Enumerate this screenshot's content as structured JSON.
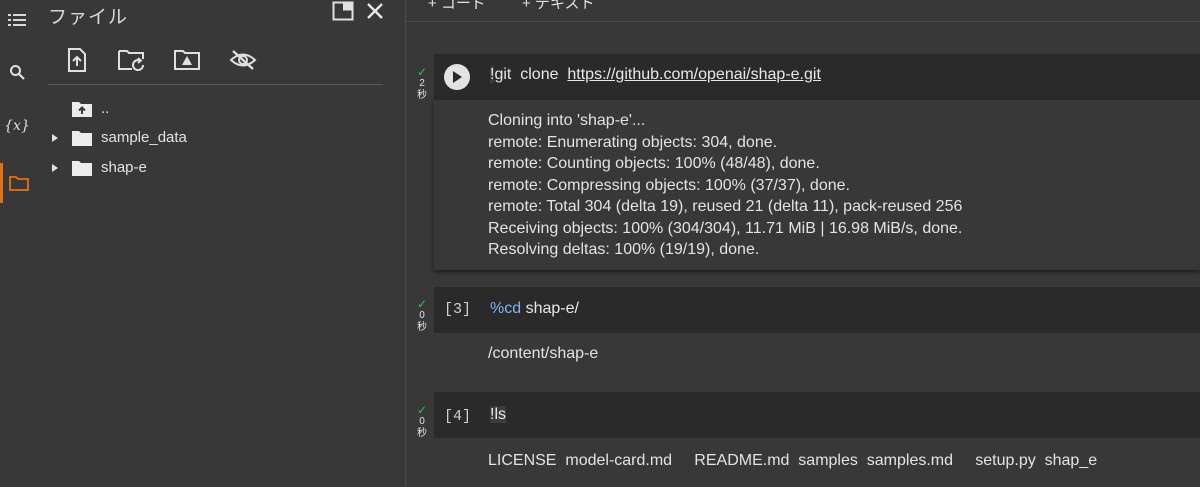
{
  "sidebar": {
    "title": "ファイル",
    "rail": [
      "menu-icon",
      "search-icon",
      "variables-icon",
      "folder-icon"
    ],
    "variables_label": "{x}",
    "tree": [
      {
        "label": "..",
        "type": "parent"
      },
      {
        "label": "sample_data",
        "type": "folder"
      },
      {
        "label": "shap-e",
        "type": "folder"
      }
    ]
  },
  "toolbar": {
    "add_code": "+ コード",
    "add_text": "+ テキスト"
  },
  "cells": [
    {
      "status_check": "✓",
      "status_time_num": "2",
      "status_time_unit": "秒",
      "prompt": "",
      "code_bang": "!",
      "code_cmd": "git  clone  ",
      "code_url": "https://github.com/openai/shap-e.git",
      "output": [
        "Cloning into 'shap-e'...",
        "remote: Enumerating objects: 304, done.",
        "remote: Counting objects: 100% (48/48), done.",
        "remote: Compressing objects: 100% (37/37), done.",
        "remote: Total 304 (delta 19), reused 21 (delta 11), pack-reused 256",
        "Receiving objects: 100% (304/304), 11.71 MiB | 16.98 MiB/s, done.",
        "Resolving deltas: 100% (19/19), done."
      ]
    },
    {
      "status_check": "✓",
      "status_time_num": "0",
      "status_time_unit": "秒",
      "prompt": "[3]",
      "code_magic": "%cd",
      "code_arg": " shap-e/",
      "output": [
        "/content/shap-e"
      ]
    },
    {
      "status_check": "✓",
      "status_time_num": "0",
      "status_time_unit": "秒",
      "prompt": "[4]",
      "code_bang": "!",
      "code_cmd": "ls",
      "output": [
        "LICENSE  model-card.md     README.md  samples  samples.md     setup.py  shap_e"
      ]
    }
  ],
  "colors": {
    "background": "#383838",
    "cell_input": "#2a2a2a",
    "accent_orange": "#e8710a",
    "check_green": "#3fb950",
    "magic_blue": "#7fb3ff"
  }
}
